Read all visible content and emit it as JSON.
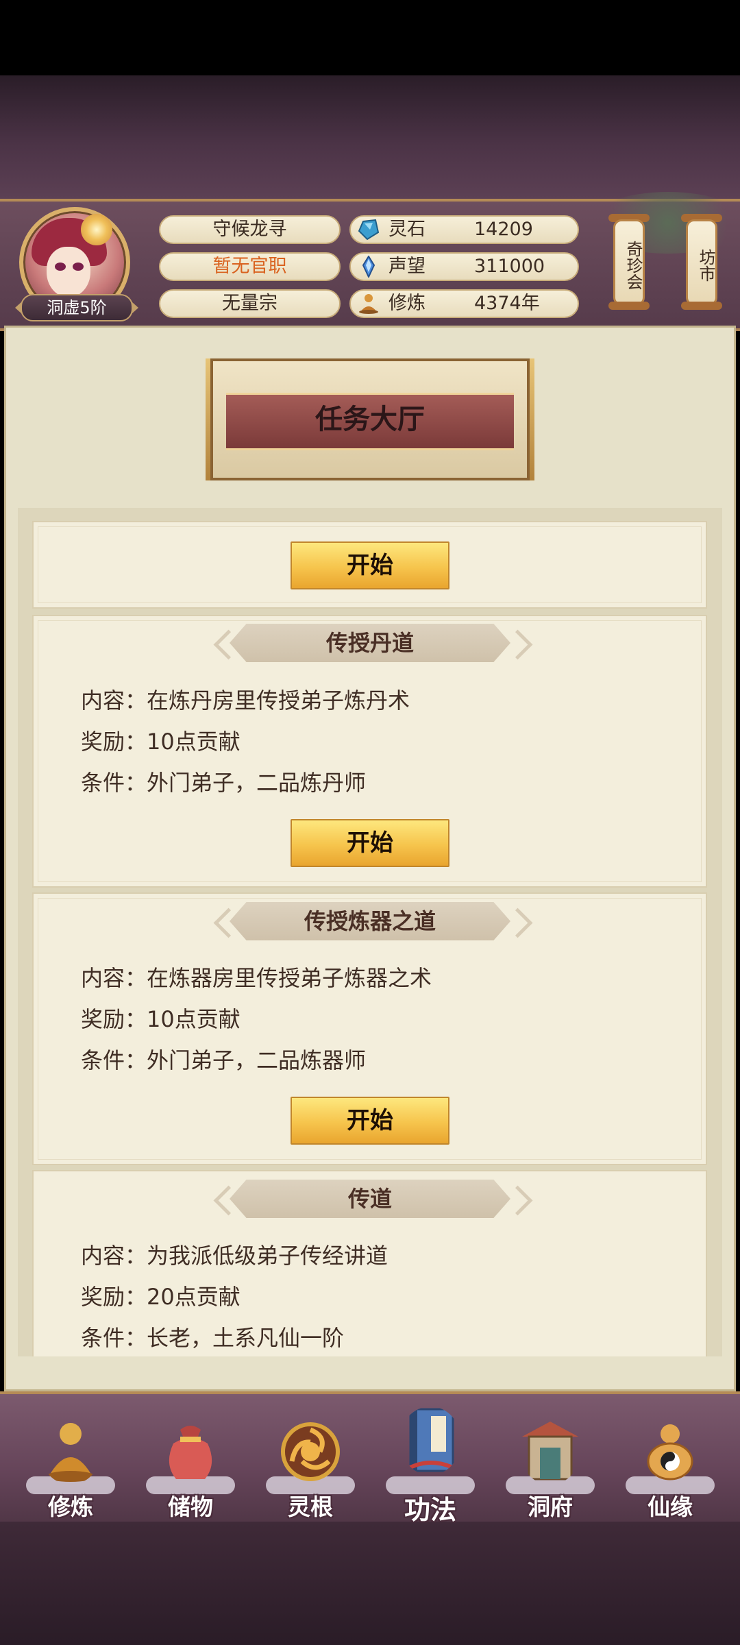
{
  "header": {
    "rank": "洞虚5阶",
    "name": "守候龙寻",
    "position": "暂无官职",
    "sect": "无量宗",
    "stats": [
      {
        "icon": "spirit-stone-icon",
        "label": "灵石",
        "value": "14209"
      },
      {
        "icon": "prestige-crystal-icon",
        "label": "声望",
        "value": "311000"
      },
      {
        "icon": "meditation-icon",
        "label": "修炼",
        "value": "4374年"
      }
    ],
    "side_buttons": [
      "奇珍会",
      "坊市"
    ]
  },
  "banner": {
    "title": "任务大厅"
  },
  "tasks": [
    {
      "start_label": "开始"
    },
    {
      "title": "传授丹道",
      "content": "内容：在炼丹房里传授弟子炼丹术",
      "reward": "奖励：10点贡献",
      "condition": "条件：外门弟子，二品炼丹师",
      "start_label": "开始"
    },
    {
      "title": "传授炼器之道",
      "content": "内容：在炼器房里传授弟子炼器之术",
      "reward": "奖励：10点贡献",
      "condition": "条件：外门弟子，二品炼器师",
      "start_label": "开始"
    },
    {
      "title": "传道",
      "content": "内容：为我派低级弟子传经讲道",
      "reward": "奖励：20点贡献",
      "condition": "条件：长老，土系凡仙一阶"
    }
  ],
  "nav": [
    {
      "label": "修炼",
      "icon": "cultivate-icon",
      "color": "#d9a33c"
    },
    {
      "label": "储物",
      "icon": "storage-bag-icon",
      "color": "#d0544e"
    },
    {
      "label": "灵根",
      "icon": "spirit-root-icon",
      "color": "#b8642e"
    },
    {
      "label": "功法",
      "icon": "technique-book-icon",
      "color": "#4f79b8"
    },
    {
      "label": "洞府",
      "icon": "cave-dwelling-icon",
      "color": "#8f9a84"
    },
    {
      "label": "仙缘",
      "icon": "immortal-fate-icon",
      "color": "#e4a74f"
    }
  ]
}
